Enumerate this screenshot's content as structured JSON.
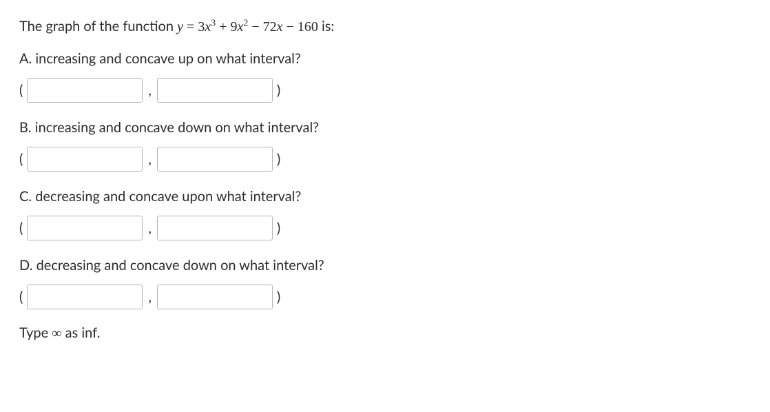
{
  "intro": {
    "prefix": "The graph of the function ",
    "equation_lhs": "y",
    "equals": " = ",
    "term1_coef": "3",
    "term1_var": "x",
    "term1_exp": "3",
    "plus1": " + ",
    "term2_coef": "9",
    "term2_var": "x",
    "term2_exp": "2",
    "minus1": " − ",
    "term3_coef": "72",
    "term3_var": "x",
    "minus2": " − ",
    "term4": "160",
    "suffix": " is:"
  },
  "parts": {
    "a": {
      "label": "A. increasing and concave up on what interval?",
      "open": "(",
      "comma": ",",
      "close": ")",
      "val1": "",
      "val2": ""
    },
    "b": {
      "label": "B. increasing and concave down on what interval?",
      "open": "(",
      "comma": ",",
      "close": ")",
      "val1": "",
      "val2": ""
    },
    "c": {
      "label": "C. decreasing and concave upon what interval?",
      "open": "(",
      "comma": ",",
      "close": ")",
      "val1": "",
      "val2": ""
    },
    "d": {
      "label": "D. decreasing and concave down on what interval?",
      "open": "(",
      "comma": ",",
      "close": ")",
      "val1": "",
      "val2": ""
    }
  },
  "hint": {
    "prefix": "Type ",
    "symbol": "∞",
    "suffix": " as inf."
  }
}
